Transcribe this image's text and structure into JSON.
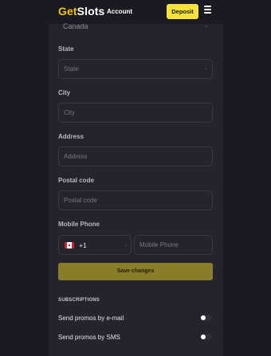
{
  "header": {
    "logo_prefix": "Get",
    "logo_suffix": "Slots",
    "account_label": "Account",
    "deposit_label": "Deposit"
  },
  "form": {
    "country_value": "Canada",
    "state": {
      "label": "State",
      "placeholder": "State"
    },
    "city": {
      "label": "City",
      "placeholder": "City"
    },
    "address": {
      "label": "Address",
      "placeholder": "Address"
    },
    "postal_code": {
      "label": "Postal code",
      "placeholder": "Postal code"
    },
    "mobile_phone": {
      "label": "Mobile Phone",
      "country_code": "+1",
      "placeholder": "Mobile Phone",
      "flag": "canada-flag"
    },
    "save_label": "Save changes"
  },
  "subscriptions": {
    "title": "SUBSCRIPTIONS",
    "items": [
      {
        "label": "Send promos by e-mail",
        "enabled": false
      },
      {
        "label": "Send promos by SMS",
        "enabled": false
      }
    ]
  },
  "colors": {
    "background": "#1a1a22",
    "panel": "#24242e",
    "brand_yellow": "#f7e13b",
    "save_button": "#8a7d2a"
  }
}
